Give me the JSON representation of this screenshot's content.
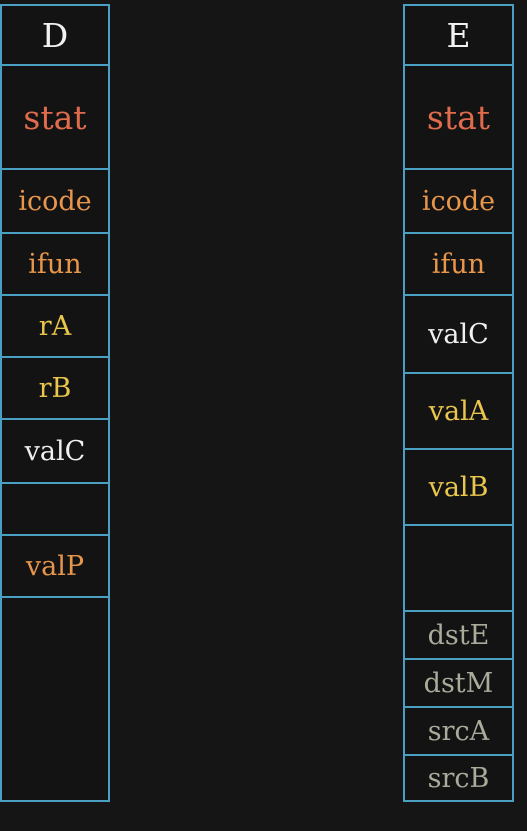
{
  "colors": {
    "background": "#151515",
    "border": "#4a9fc2",
    "stat": "#e06b4d",
    "control": "#e8964b",
    "register": "#e9c64c",
    "value": "#f0f0f0",
    "dest_src": "#a9ab9b"
  },
  "stage_d": {
    "title": "D",
    "fields": {
      "stat": "stat",
      "icode": "icode",
      "ifun": "ifun",
      "ra": "rA",
      "rb": "rB",
      "valc": "valC",
      "valp": "valP"
    }
  },
  "stage_e": {
    "title": "E",
    "fields": {
      "stat": "stat",
      "icode": "icode",
      "ifun": "ifun",
      "valc": "valC",
      "vala": "valA",
      "valb": "valB",
      "dste": "dstE",
      "dstm": "dstM",
      "srca": "srcA",
      "srcb": "srcB"
    }
  }
}
